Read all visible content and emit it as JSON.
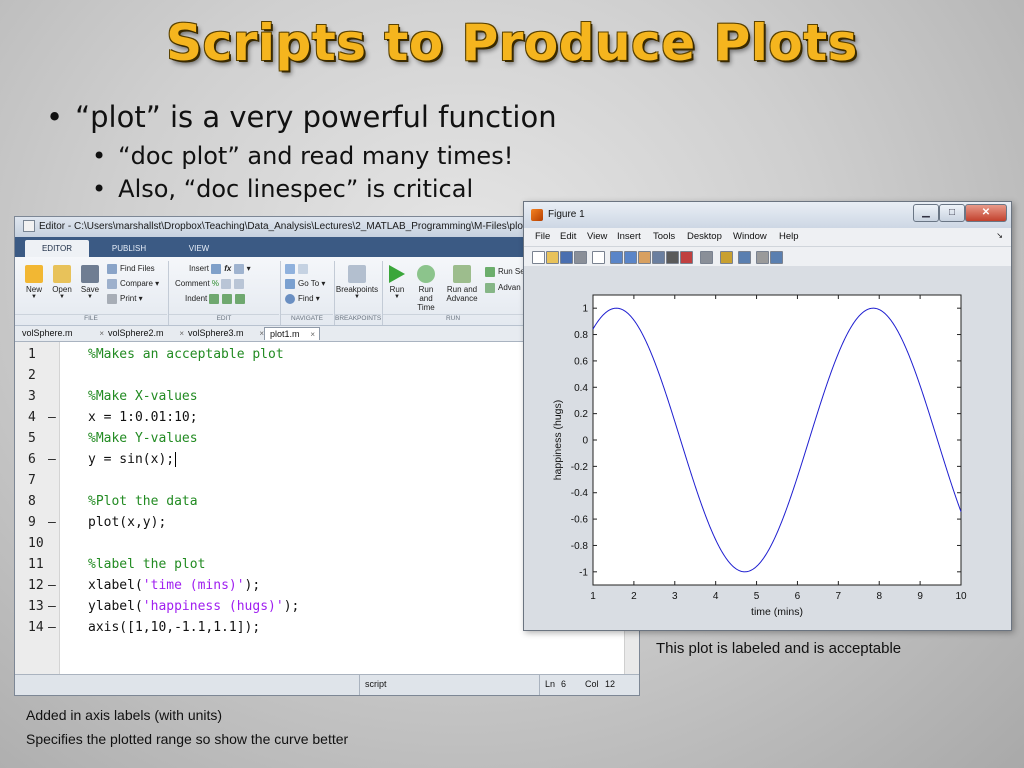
{
  "slide": {
    "title": "Scripts to Produce Plots",
    "bullets": [
      "“plot” is a very powerful function",
      "“doc plot” and read many times!",
      "Also, “doc linespec” is critical"
    ],
    "bullet_glyph": "•",
    "caption_figure": "This plot is labeled and is acceptable",
    "caption_editor_1": "Added in axis labels (with units)",
    "caption_editor_2": "Specifies the plotted range so show the curve better"
  },
  "editor": {
    "title": "Editor - C:\\Users\\marshallst\\Dropbox\\Teaching\\Data_Analysis\\Lectures\\2_MATLAB_Programming\\M-Files\\plot1.m",
    "ribbon_tabs": [
      "EDITOR",
      "PUBLISH",
      "VIEW"
    ],
    "file_group": {
      "new": "New",
      "open": "Open",
      "save": "Save",
      "find_files": "Find Files",
      "compare": "Compare",
      "print": "Print",
      "label": "FILE"
    },
    "edit_group": {
      "insert": "Insert",
      "comment": "Comment",
      "indent": "Indent",
      "label": "EDIT"
    },
    "navigate_group": {
      "go_to": "Go To",
      "find": "Find",
      "label": "NAVIGATE"
    },
    "breakpoints_group": {
      "breakpoints": "Breakpoints",
      "label": "BREAKPOINTS"
    },
    "run_group": {
      "run": "Run",
      "run_and_time_1": "Run and",
      "run_and_time_2": "Time",
      "run_and_advance_1": "Run and",
      "run_and_advance_2": "Advance",
      "run_section": "Run Se",
      "advance": "Advan",
      "label": "RUN"
    },
    "file_tabs": [
      "volSphere.m",
      "volSphere2.m",
      "volSphere3.m",
      "plot1.m"
    ],
    "active_file_tab": 3,
    "lines": [
      {
        "n": "1",
        "dash": "",
        "segments": [
          {
            "t": "%Makes an acceptable plot",
            "c": "comment"
          }
        ]
      },
      {
        "n": "2",
        "dash": "",
        "segments": []
      },
      {
        "n": "3",
        "dash": "",
        "segments": [
          {
            "t": "%Make X-values",
            "c": "comment"
          }
        ]
      },
      {
        "n": "4",
        "dash": "—",
        "segments": [
          {
            "t": "x = 1:0.01:10;",
            "c": ""
          }
        ]
      },
      {
        "n": "5",
        "dash": "",
        "segments": [
          {
            "t": "%Make Y-values",
            "c": "comment"
          }
        ]
      },
      {
        "n": "6",
        "dash": "—",
        "segments": [
          {
            "t": "y = sin(x);",
            "c": ""
          }
        ],
        "caret": true
      },
      {
        "n": "7",
        "dash": "",
        "segments": []
      },
      {
        "n": "8",
        "dash": "",
        "segments": [
          {
            "t": "%Plot the data",
            "c": "comment"
          }
        ]
      },
      {
        "n": "9",
        "dash": "—",
        "segments": [
          {
            "t": "plot(x,y);",
            "c": ""
          }
        ]
      },
      {
        "n": "10",
        "dash": "",
        "segments": []
      },
      {
        "n": "11",
        "dash": "",
        "segments": [
          {
            "t": "%label the plot",
            "c": "comment"
          }
        ]
      },
      {
        "n": "12",
        "dash": "—",
        "segments": [
          {
            "t": "xlabel(",
            "c": ""
          },
          {
            "t": "'time (mins)'",
            "c": "str"
          },
          {
            "t": ");",
            "c": ""
          }
        ]
      },
      {
        "n": "13",
        "dash": "—",
        "segments": [
          {
            "t": "ylabel(",
            "c": ""
          },
          {
            "t": "'happiness (hugs)'",
            "c": "str"
          },
          {
            "t": ");",
            "c": ""
          }
        ]
      },
      {
        "n": "14",
        "dash": "—",
        "segments": [
          {
            "t": "axis([1,10,-1.1,1.1]);",
            "c": ""
          }
        ]
      }
    ],
    "status": {
      "mode": "script",
      "ln_label": "Ln",
      "ln": "6",
      "col_label": "Col",
      "col": "12"
    }
  },
  "figure": {
    "title": "Figure 1",
    "menu": [
      "File",
      "Edit",
      "View",
      "Insert",
      "Tools",
      "Desktop",
      "Window",
      "Help"
    ],
    "toolbar_icons": [
      "new-figure-icon",
      "open-icon",
      "save-icon",
      "print-icon",
      "pointer-icon",
      "zoom-in-icon",
      "zoom-out-icon",
      "pan-icon",
      "rotate-icon",
      "data-cursor-icon",
      "brush-icon",
      "link-icon",
      "colorbar-icon",
      "legend-icon",
      "hide-tools-icon",
      "show-tools-icon"
    ],
    "line_color": "#1f1fd0"
  },
  "chart_data": {
    "type": "line",
    "function": "y = sin(x)",
    "x_start": 1,
    "x_end": 10,
    "x_step": 0.01,
    "xlabel": "time (mins)",
    "ylabel": "happiness (hugs)",
    "xlim": [
      1,
      10
    ],
    "ylim": [
      -1.1,
      1.1
    ],
    "xticks": [
      1,
      2,
      3,
      4,
      5,
      6,
      7,
      8,
      9,
      10
    ],
    "yticks": [
      -1,
      -0.8,
      -0.6,
      -0.4,
      -0.2,
      0,
      0.2,
      0.4,
      0.6,
      0.8,
      1
    ],
    "ytick_labels": [
      "-1",
      "-0.8",
      "-0.6",
      "-0.4",
      "-0.2",
      "0",
      "0.2",
      "0.4",
      "0.6",
      "0.8",
      "1"
    ],
    "grid": false
  }
}
